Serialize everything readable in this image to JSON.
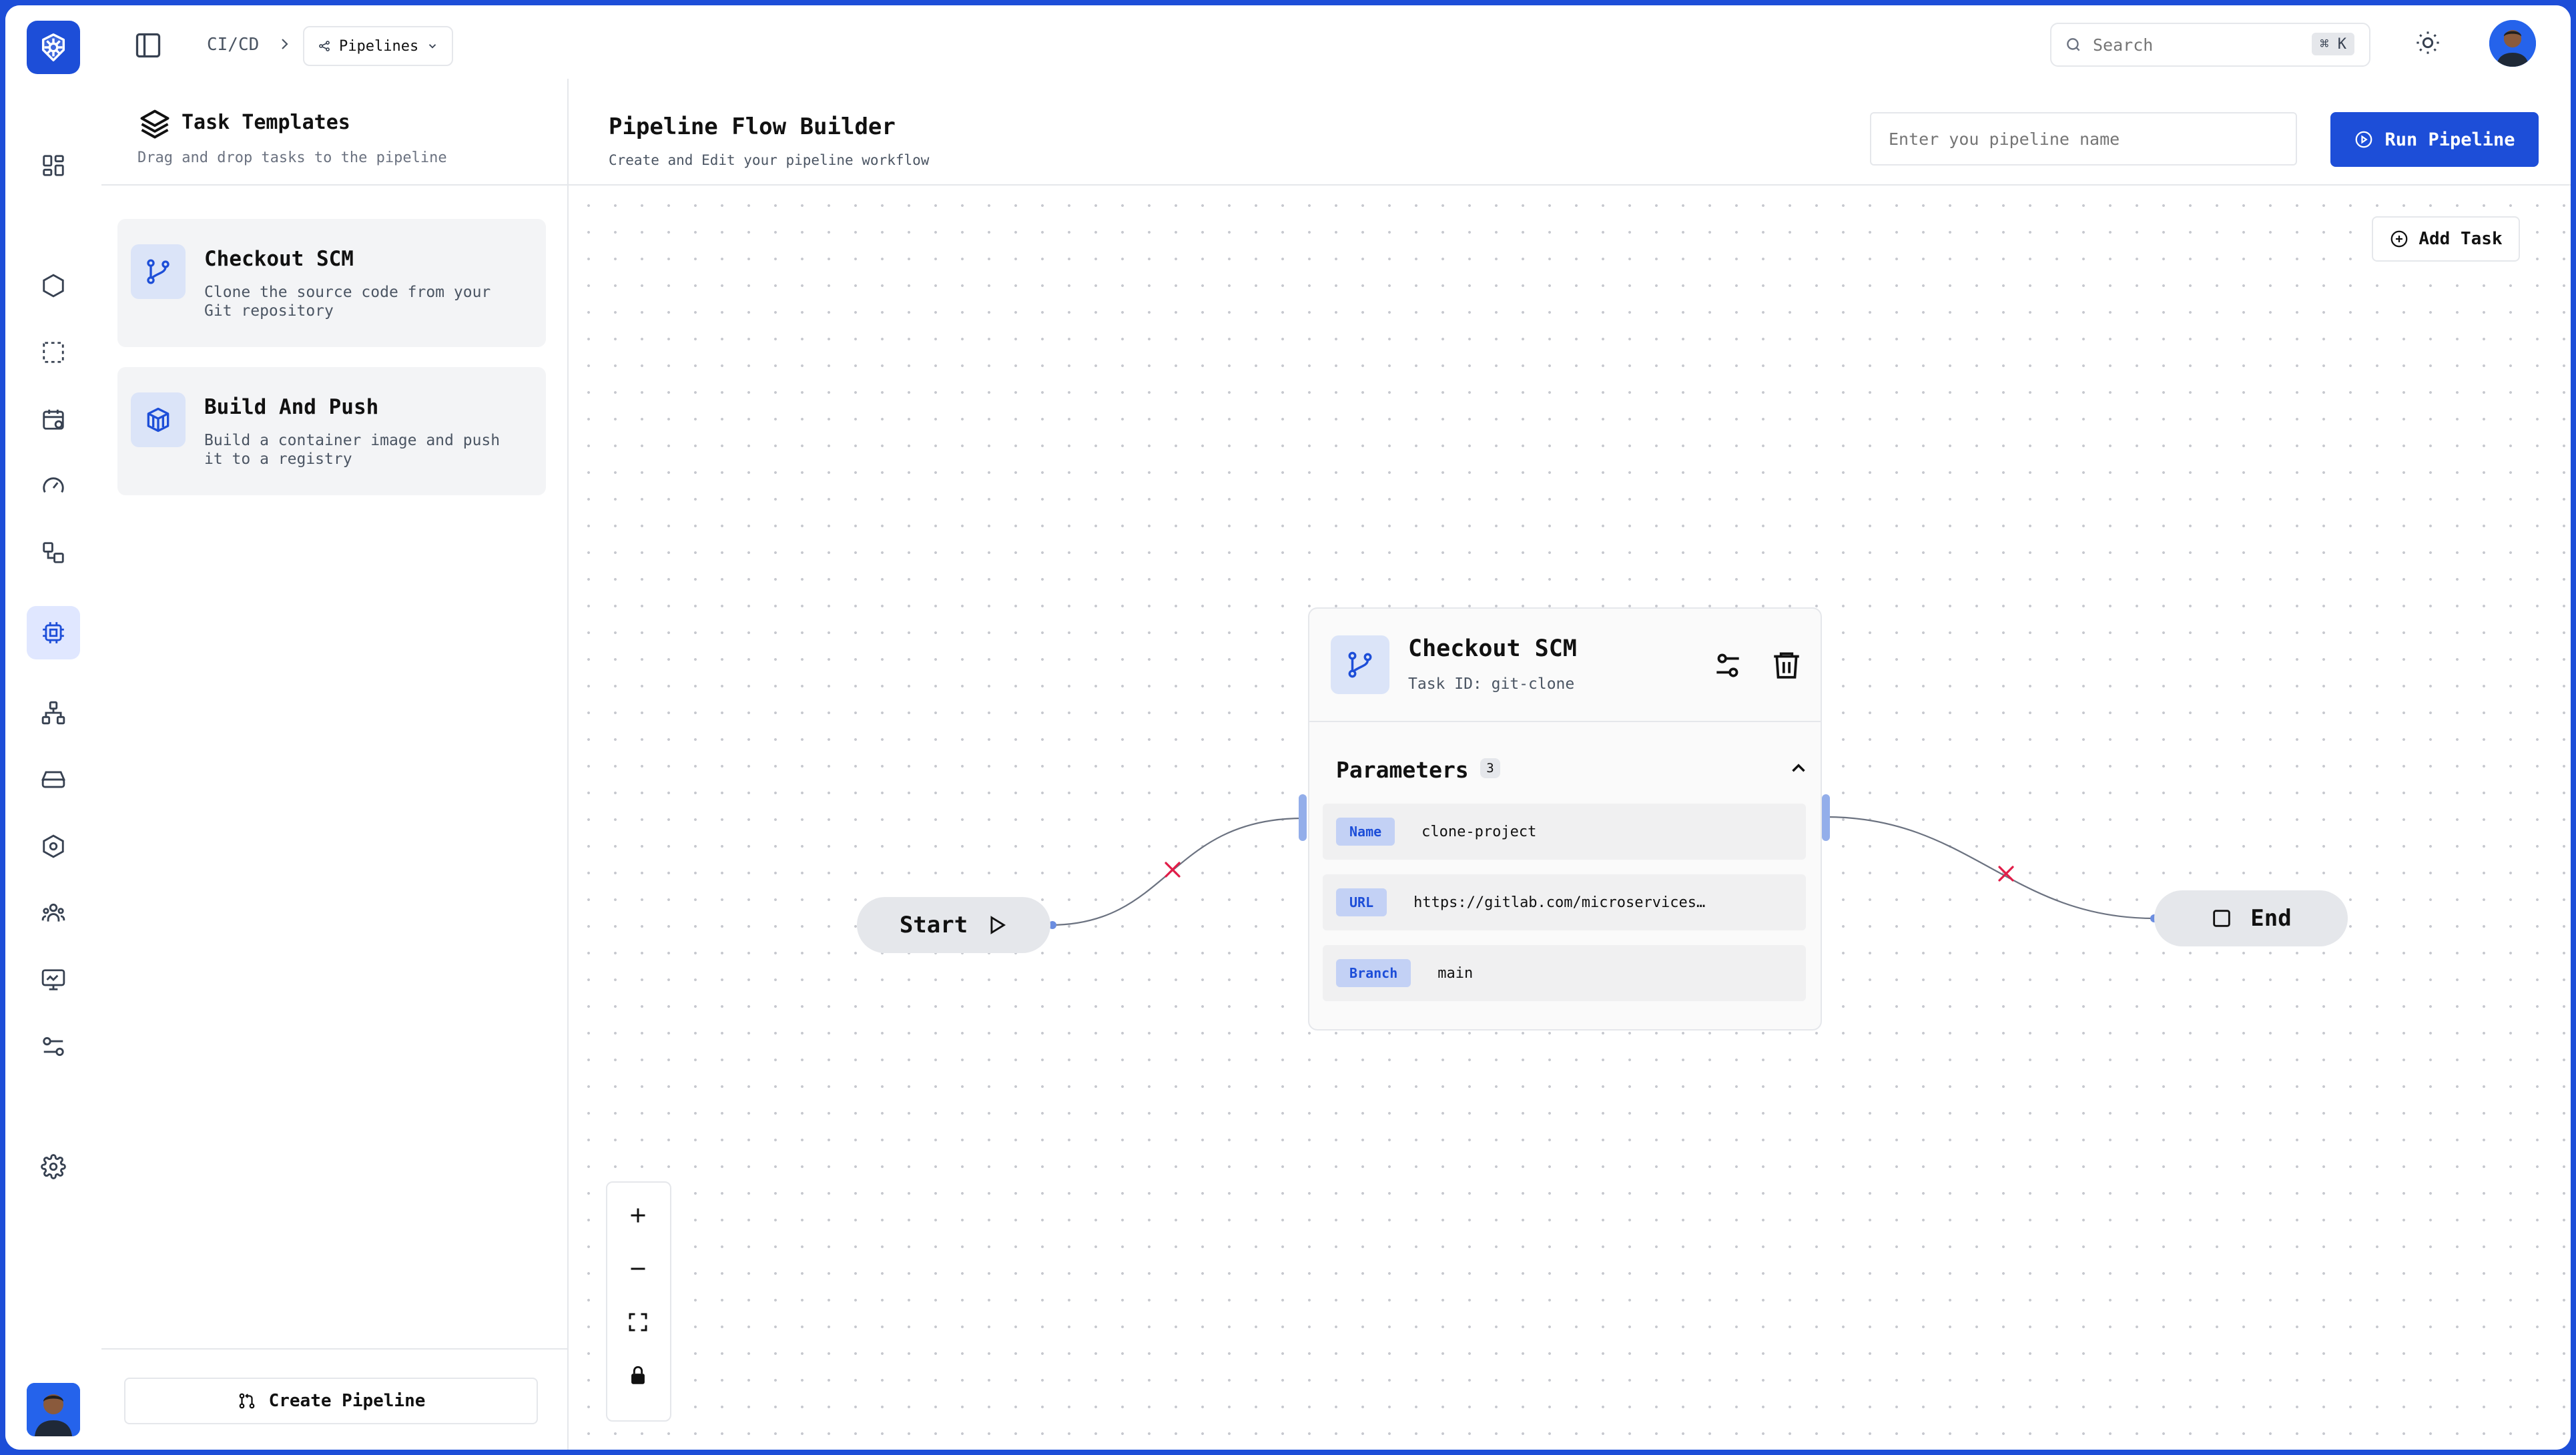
{
  "header": {
    "breadcrumb_section": "CI/CD",
    "breadcrumb_page": "Pipelines",
    "search_placeholder": "Search",
    "search_shortcut": "⌘ K"
  },
  "templates": {
    "title": "Task Templates",
    "subtitle": "Drag and drop tasks to the pipeline",
    "items": [
      {
        "name": "Checkout SCM",
        "description": "Clone the source code from your Git repository"
      },
      {
        "name": "Build And Push",
        "description": "Build a container image and push it to a registry"
      }
    ],
    "create_label": "Create Pipeline"
  },
  "builder": {
    "title": "Pipeline Flow Builder",
    "subtitle": "Create and Edit your pipeline workflow",
    "name_placeholder": "Enter you pipeline name",
    "run_label": "Run Pipeline",
    "add_task_label": "Add Task"
  },
  "canvas": {
    "start_label": "Start",
    "end_label": "End",
    "task": {
      "name": "Checkout SCM",
      "task_id": "Task ID: git-clone",
      "parameters_label": "Parameters",
      "parameters_count": "3",
      "params": [
        {
          "key": "Name",
          "value": "clone-project"
        },
        {
          "key": "URL",
          "value": "https://gitlab.com/microservices…"
        },
        {
          "key": "Branch",
          "value": "main"
        }
      ]
    }
  },
  "colors": {
    "accent": "#1d4ed8",
    "edge_delete": "#e11d48",
    "handle": "#93aeea"
  }
}
